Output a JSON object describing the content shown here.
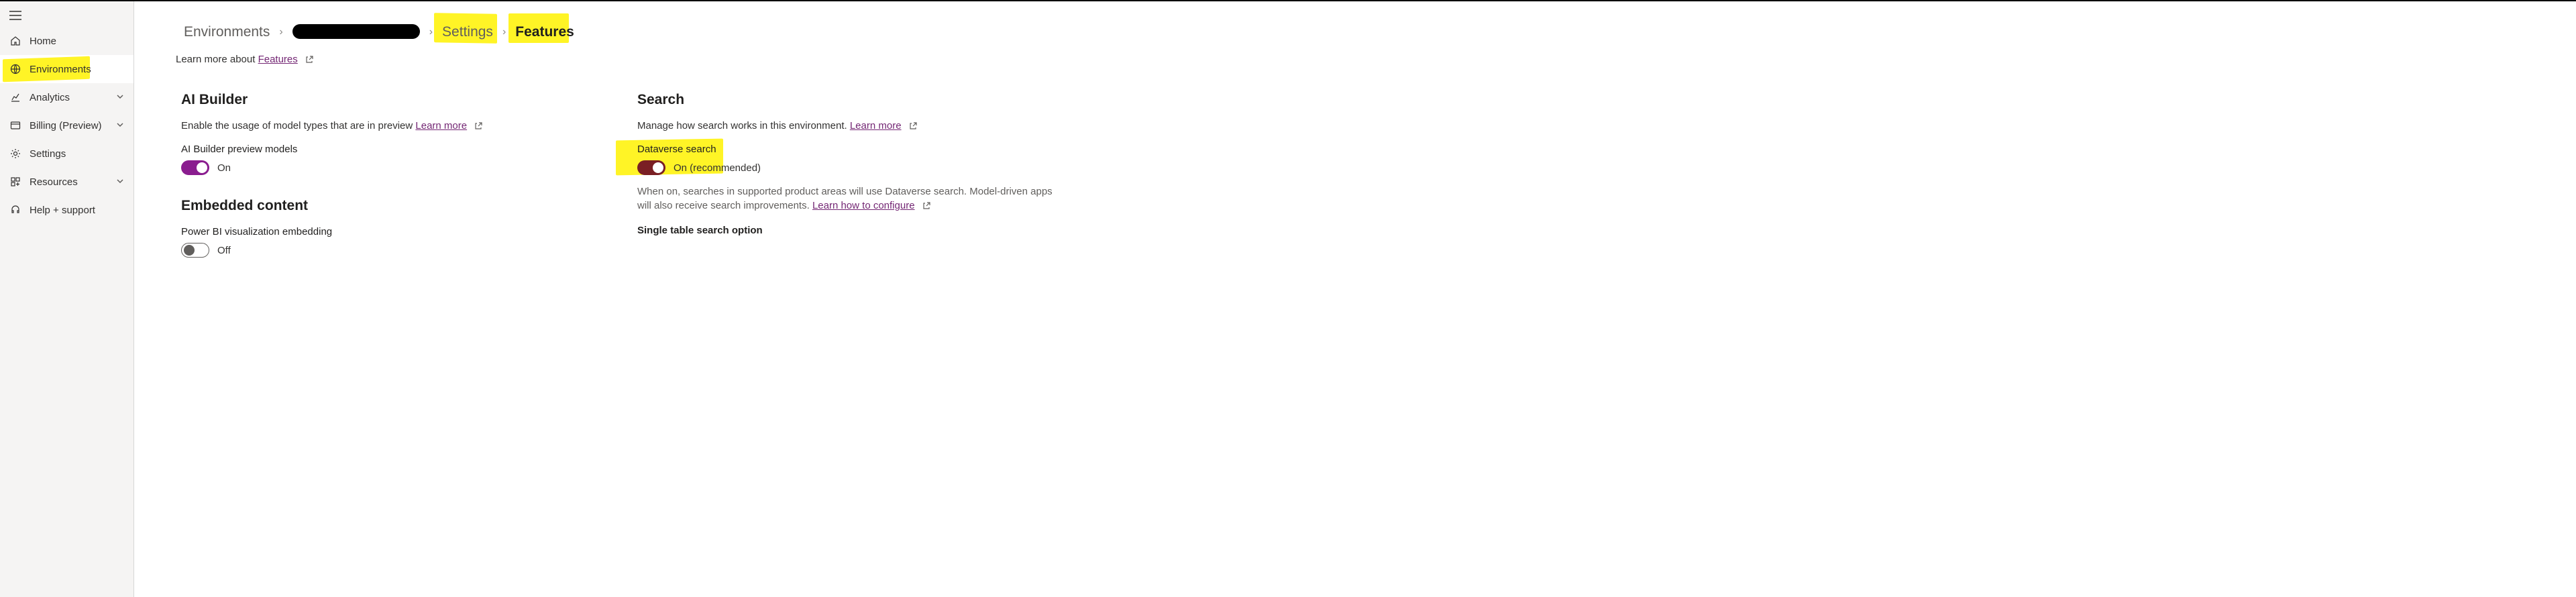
{
  "sidebar": {
    "items": [
      {
        "label": "Home"
      },
      {
        "label": "Environments"
      },
      {
        "label": "Analytics"
      },
      {
        "label": "Billing (Preview)"
      },
      {
        "label": "Settings"
      },
      {
        "label": "Resources"
      },
      {
        "label": "Help + support"
      }
    ]
  },
  "breadcrumb": {
    "environments": "Environments",
    "settings": "Settings",
    "features": "Features"
  },
  "learn_more": {
    "prefix": "Learn more about ",
    "link": "Features"
  },
  "ai_builder": {
    "title": "AI Builder",
    "desc": "Enable the usage of model types that are in preview ",
    "learn_more": "Learn more",
    "field_label": "AI Builder preview models",
    "toggle_state": "On"
  },
  "embedded": {
    "title": "Embedded content",
    "field_label": "Power BI visualization embedding",
    "toggle_state": "Off"
  },
  "search": {
    "title": "Search",
    "desc": "Manage how search works in this environment. ",
    "learn_more": "Learn more",
    "dataverse_label": "Dataverse search",
    "dataverse_state": "On (recommended)",
    "dataverse_desc_1": "When on, searches in supported product areas will use Dataverse search. Model-driven apps will also receive search improvements. ",
    "configure_link": "Learn how to configure",
    "single_table_label": "Single table search option"
  }
}
